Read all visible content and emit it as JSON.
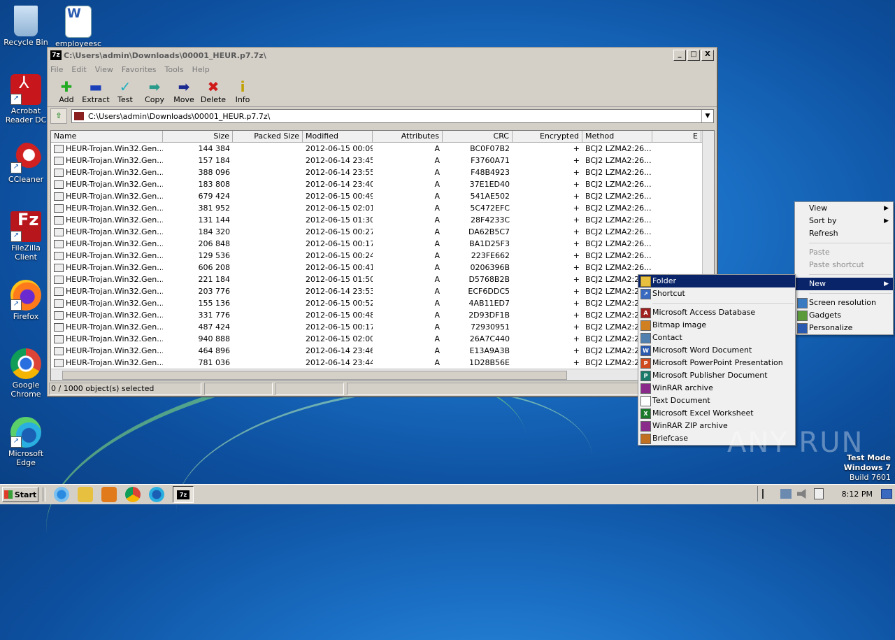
{
  "desktop": {
    "icons": [
      {
        "label": "Recycle Bin"
      },
      {
        "label": "employeesc"
      },
      {
        "label": "Acrobat Reader DC"
      },
      {
        "label": "CCleaner"
      },
      {
        "label": "FileZilla Client"
      },
      {
        "label": "Firefox"
      },
      {
        "label": "Google Chrome"
      },
      {
        "label": "Microsoft Edge"
      }
    ]
  },
  "window": {
    "title": "C:\\Users\\admin\\Downloads\\00001_HEUR.p7.7z\\",
    "app_icon": "7z",
    "controls": {
      "minimize": "_",
      "maximize": "□",
      "close": "X"
    },
    "menu": [
      "File",
      "Edit",
      "View",
      "Favorites",
      "Tools",
      "Help"
    ],
    "toolbar": [
      {
        "label": "Add",
        "icon": "plus-icon",
        "glyph": "✚",
        "color": "#22aa22"
      },
      {
        "label": "Extract",
        "icon": "minus-icon",
        "glyph": "▬",
        "color": "#1a3fb8"
      },
      {
        "label": "Test",
        "icon": "check-icon",
        "glyph": "✓",
        "color": "#20b0c0"
      },
      {
        "label": "Copy",
        "icon": "copy-arrow-icon",
        "glyph": "➡",
        "color": "#2a9a8a"
      },
      {
        "label": "Move",
        "icon": "move-arrow-icon",
        "glyph": "➡",
        "color": "#1a2a90"
      },
      {
        "label": "Delete",
        "icon": "delete-x-icon",
        "glyph": "✖",
        "color": "#d01a1a"
      },
      {
        "label": "Info",
        "icon": "info-icon",
        "glyph": "i",
        "color": "#c0a000"
      }
    ],
    "address": "C:\\Users\\admin\\Downloads\\00001_HEUR.p7.7z\\",
    "columns": [
      "Name",
      "Size",
      "Packed Size",
      "Modified",
      "Attributes",
      "CRC",
      "Encrypted",
      "Method",
      "E"
    ],
    "rows": [
      {
        "name": "HEUR-Trojan.Win32.Gen...",
        "size": "144 384",
        "packed": "",
        "modified": "2012-06-15 00:09",
        "attr": "A",
        "crc": "BC0F07B2",
        "enc": "+",
        "method": "BCJ2 LZMA2:26..."
      },
      {
        "name": "HEUR-Trojan.Win32.Gen...",
        "size": "157 184",
        "packed": "",
        "modified": "2012-06-14 23:45",
        "attr": "A",
        "crc": "F3760A71",
        "enc": "+",
        "method": "BCJ2 LZMA2:26..."
      },
      {
        "name": "HEUR-Trojan.Win32.Gen...",
        "size": "388 096",
        "packed": "",
        "modified": "2012-06-14 23:55",
        "attr": "A",
        "crc": "F48B4923",
        "enc": "+",
        "method": "BCJ2 LZMA2:26..."
      },
      {
        "name": "HEUR-Trojan.Win32.Gen...",
        "size": "183 808",
        "packed": "",
        "modified": "2012-06-14 23:40",
        "attr": "A",
        "crc": "37E1ED40",
        "enc": "+",
        "method": "BCJ2 LZMA2:26..."
      },
      {
        "name": "HEUR-Trojan.Win32.Gen...",
        "size": "679 424",
        "packed": "",
        "modified": "2012-06-15 00:49",
        "attr": "A",
        "crc": "541AE502",
        "enc": "+",
        "method": "BCJ2 LZMA2:26..."
      },
      {
        "name": "HEUR-Trojan.Win32.Gen...",
        "size": "381 952",
        "packed": "",
        "modified": "2012-06-15 02:01",
        "attr": "A",
        "crc": "5C472EFC",
        "enc": "+",
        "method": "BCJ2 LZMA2:26..."
      },
      {
        "name": "HEUR-Trojan.Win32.Gen...",
        "size": "131 144",
        "packed": "",
        "modified": "2012-06-15 01:30",
        "attr": "A",
        "crc": "28F4233C",
        "enc": "+",
        "method": "BCJ2 LZMA2:26..."
      },
      {
        "name": "HEUR-Trojan.Win32.Gen...",
        "size": "184 320",
        "packed": "",
        "modified": "2012-06-15 00:27",
        "attr": "A",
        "crc": "DA62B5C7",
        "enc": "+",
        "method": "BCJ2 LZMA2:26..."
      },
      {
        "name": "HEUR-Trojan.Win32.Gen...",
        "size": "206 848",
        "packed": "",
        "modified": "2012-06-15 00:17",
        "attr": "A",
        "crc": "BA1D25F3",
        "enc": "+",
        "method": "BCJ2 LZMA2:26..."
      },
      {
        "name": "HEUR-Trojan.Win32.Gen...",
        "size": "129 536",
        "packed": "",
        "modified": "2012-06-15 00:24",
        "attr": "A",
        "crc": "223FE662",
        "enc": "+",
        "method": "BCJ2 LZMA2:26..."
      },
      {
        "name": "HEUR-Trojan.Win32.Gen...",
        "size": "606 208",
        "packed": "",
        "modified": "2012-06-15 00:41",
        "attr": "A",
        "crc": "0206396B",
        "enc": "+",
        "method": "BCJ2 LZMA2:26..."
      },
      {
        "name": "HEUR-Trojan.Win32.Gen...",
        "size": "221 184",
        "packed": "",
        "modified": "2012-06-15 01:50",
        "attr": "A",
        "crc": "D5768B2B",
        "enc": "+",
        "method": "BCJ2 LZMA2:26..."
      },
      {
        "name": "HEUR-Trojan.Win32.Gen...",
        "size": "203 776",
        "packed": "",
        "modified": "2012-06-14 23:53",
        "attr": "A",
        "crc": "ECF6DDC5",
        "enc": "+",
        "method": "BCJ2 LZMA2:26..."
      },
      {
        "name": "HEUR-Trojan.Win32.Gen...",
        "size": "155 136",
        "packed": "",
        "modified": "2012-06-15 00:52",
        "attr": "A",
        "crc": "4AB11ED7",
        "enc": "+",
        "method": "BCJ2 LZMA2:26..."
      },
      {
        "name": "HEUR-Trojan.Win32.Gen...",
        "size": "331 776",
        "packed": "",
        "modified": "2012-06-15 00:48",
        "attr": "A",
        "crc": "2D93DF1B",
        "enc": "+",
        "method": "BCJ2 LZMA2:26..."
      },
      {
        "name": "HEUR-Trojan.Win32.Gen...",
        "size": "487 424",
        "packed": "",
        "modified": "2012-06-15 00:17",
        "attr": "A",
        "crc": "72930951",
        "enc": "+",
        "method": "BCJ2 LZMA2:26..."
      },
      {
        "name": "HEUR-Trojan.Win32.Gen...",
        "size": "940 888",
        "packed": "",
        "modified": "2012-06-15 02:00",
        "attr": "A",
        "crc": "26A7C440",
        "enc": "+",
        "method": "BCJ2 LZMA2:26..."
      },
      {
        "name": "HEUR-Trojan.Win32.Gen...",
        "size": "464 896",
        "packed": "",
        "modified": "2012-06-14 23:46",
        "attr": "A",
        "crc": "E13A9A3B",
        "enc": "+",
        "method": "BCJ2 LZMA2:26..."
      },
      {
        "name": "HEUR-Trojan.Win32.Gen...",
        "size": "781 036",
        "packed": "",
        "modified": "2012-06-14 23:44",
        "attr": "A",
        "crc": "1D28B56E",
        "enc": "+",
        "method": "BCJ2 LZMA2:26..."
      }
    ],
    "status": "0 / 1000 object(s) selected"
  },
  "context_menu": {
    "items": [
      {
        "label": "View",
        "submenu": true,
        "disabled": false
      },
      {
        "label": "Sort by",
        "submenu": true,
        "disabled": false
      },
      {
        "label": "Refresh",
        "submenu": false,
        "disabled": false
      },
      {
        "sep": true
      },
      {
        "label": "Paste",
        "submenu": false,
        "disabled": true
      },
      {
        "label": "Paste shortcut",
        "submenu": false,
        "disabled": true
      },
      {
        "sep": true
      },
      {
        "label": "New",
        "submenu": true,
        "disabled": false,
        "highlight": true
      },
      {
        "sep": true
      },
      {
        "label": "Screen resolution",
        "submenu": false,
        "disabled": false,
        "icon": "monitor-icon"
      },
      {
        "label": "Gadgets",
        "submenu": false,
        "disabled": false,
        "icon": "gadgets-icon"
      },
      {
        "label": "Personalize",
        "submenu": false,
        "disabled": false,
        "icon": "personalize-icon"
      }
    ]
  },
  "new_submenu": {
    "items": [
      {
        "label": "Folder",
        "icon": "folder-icon",
        "color": "#e8c040",
        "highlight": true
      },
      {
        "label": "Shortcut",
        "icon": "shortcut-icon",
        "color": "#3a6ac0"
      },
      {
        "sep": true
      },
      {
        "label": "Microsoft Access Database",
        "icon": "access-icon",
        "color": "#a02020"
      },
      {
        "label": "Bitmap image",
        "icon": "bitmap-icon",
        "color": "#d08020"
      },
      {
        "label": "Contact",
        "icon": "contact-icon",
        "color": "#5080b0"
      },
      {
        "label": "Microsoft Word Document",
        "icon": "word-icon",
        "color": "#2a5ab0"
      },
      {
        "label": "Microsoft PowerPoint Presentation",
        "icon": "powerpoint-icon",
        "color": "#d04a20"
      },
      {
        "label": "Microsoft Publisher Document",
        "icon": "publisher-icon",
        "color": "#1a7a6a"
      },
      {
        "label": "WinRAR archive",
        "icon": "winrar-icon",
        "color": "#8a2a8a"
      },
      {
        "label": "Text Document",
        "icon": "text-document-icon",
        "color": "#ffffff"
      },
      {
        "label": "Microsoft Excel Worksheet",
        "icon": "excel-icon",
        "color": "#1a7a2a"
      },
      {
        "label": "WinRAR ZIP archive",
        "icon": "winrar-zip-icon",
        "color": "#8a2a8a"
      },
      {
        "label": "Briefcase",
        "icon": "briefcase-icon",
        "color": "#c07020"
      }
    ]
  },
  "watermark": "ANY RUN",
  "testmode": {
    "line1": "Test Mode",
    "line2": "Windows 7",
    "line3": "Build 7601"
  },
  "taskbar": {
    "start": "Start",
    "clock": "8:12 PM"
  }
}
